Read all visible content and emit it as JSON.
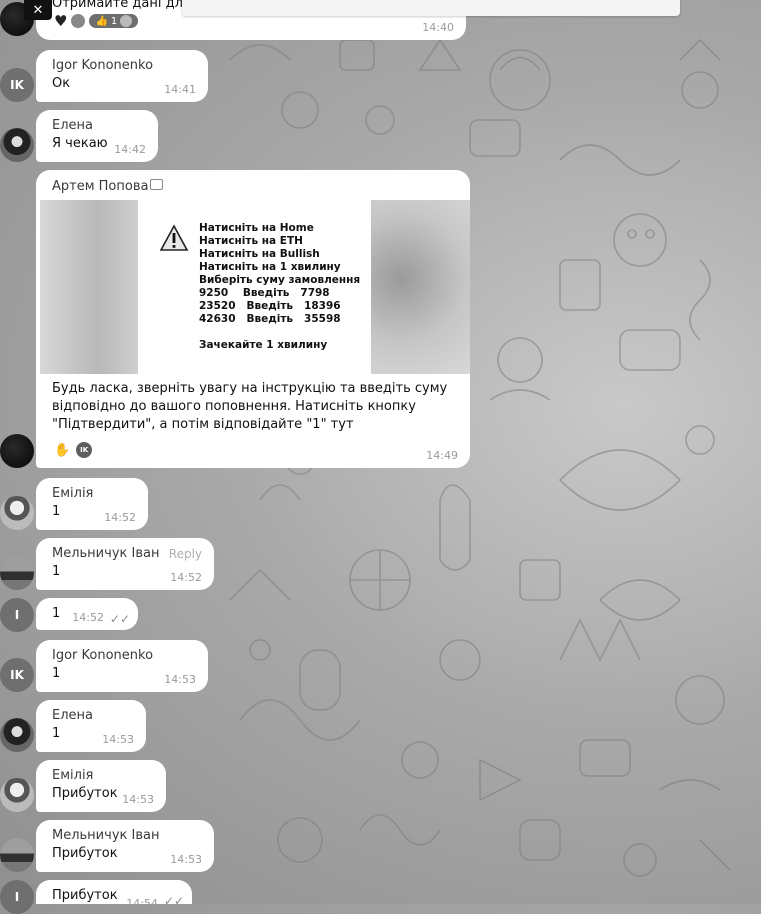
{
  "top": {
    "partial_text": "Отримайте дані для г",
    "time": "14:40",
    "close_icon": "close-icon",
    "reactions": [
      "heart-icon",
      "avatar",
      "thumbs-up-icon"
    ],
    "reaction_badge": "1"
  },
  "messages": [
    {
      "sender": "Igor Kononenko",
      "text": "Ок",
      "time": "14:41",
      "avatar_text": "IK"
    },
    {
      "sender": "Елена",
      "text": "Я чекаю",
      "time": "14:42"
    },
    {
      "sender": "Артем Попова",
      "sender_badge_icon": "briefcase-icon",
      "image": {
        "warning_icon": "warning-icon",
        "lines": [
          "Натисніть на Home",
          "Натисніть на ETH",
          "Натисніть на Bullish",
          "Натисніть на 1 хвилину",
          "Виберіть суму замовлення",
          "9250    Введіть   7798",
          "23520   Введіть   18396",
          "42630   Введіть   35598",
          "",
          "Зачекайте 1 хвилину"
        ]
      },
      "body": [
        "Будь ласка, зверніть увагу на інструкцію та введіть суму",
        "відповідно до вашого поповнення. Натисніть кнопку",
        "\"Підтвердити\", а потім відповідайте \"1\" тут"
      ],
      "reactions": [
        "hand-icon"
      ],
      "reaction_avatar": "IK",
      "time": "14:49"
    },
    {
      "sender": "Емілія",
      "text": "1",
      "time": "14:52"
    },
    {
      "sender": "Мельничук Іван",
      "text": "1",
      "time": "14:52",
      "reply_label": "Reply"
    },
    {
      "text": "1",
      "time": "14:52",
      "avatar_text": "I"
    },
    {
      "sender": "Igor Kononenko",
      "text": "1",
      "time": "14:53",
      "avatar_text": "IK"
    },
    {
      "sender": "Елена",
      "text": "1",
      "time": "14:53"
    },
    {
      "sender": "Емілія",
      "text": "Прибуток",
      "time": "14:53"
    },
    {
      "sender": "Мельничук Іван",
      "text": "Прибуток",
      "time": "14:53"
    },
    {
      "text": "Прибуток",
      "time": "14:54",
      "avatar_text": "I"
    }
  ]
}
